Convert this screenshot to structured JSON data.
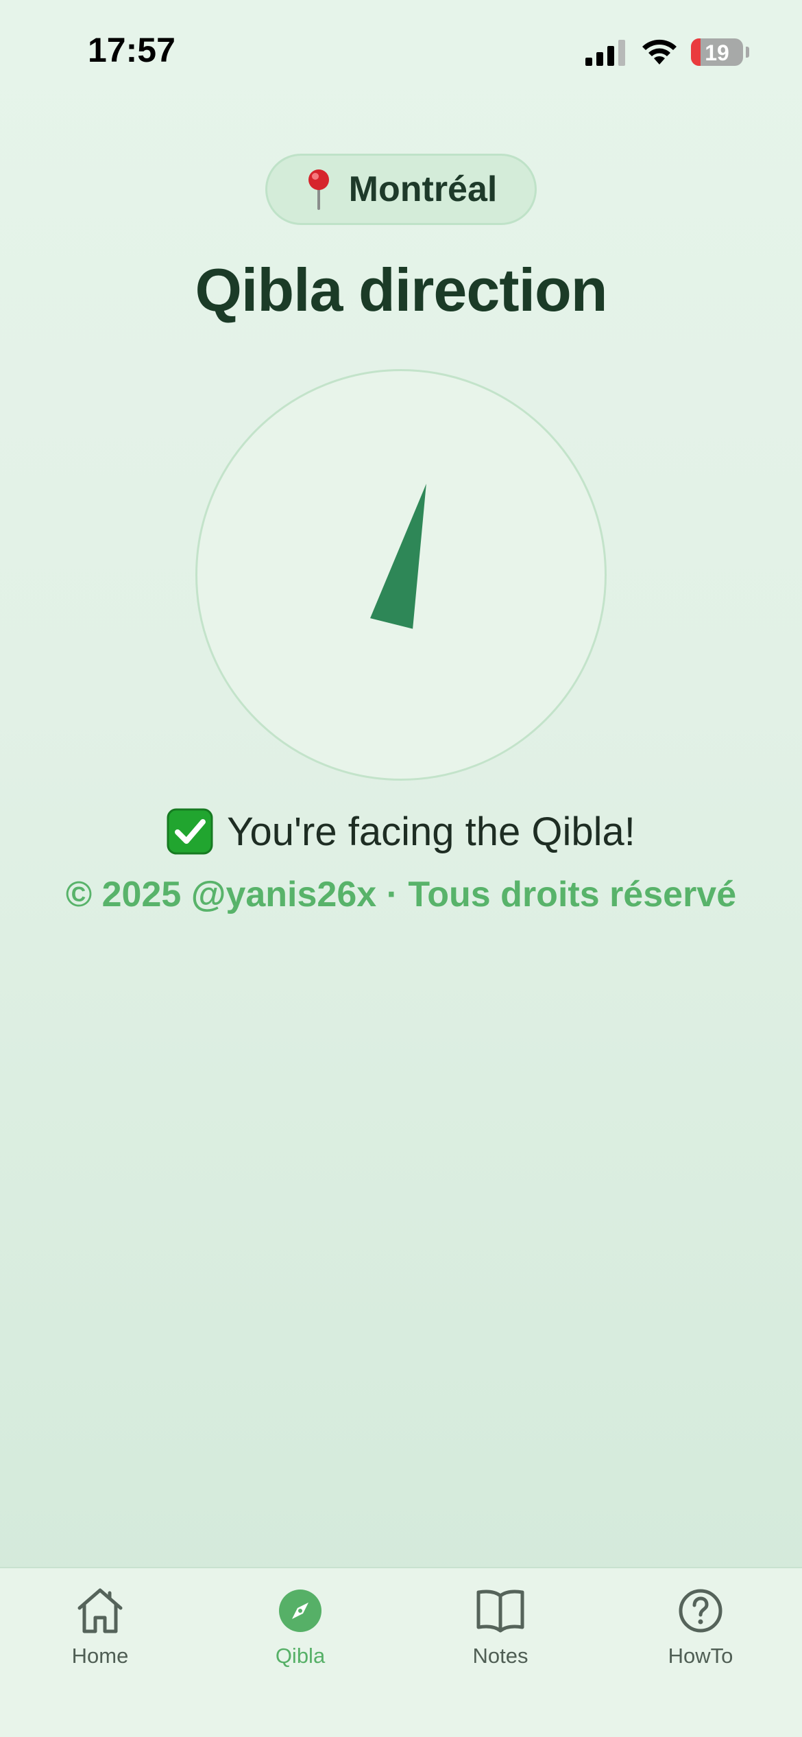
{
  "status_bar": {
    "time": "17:57",
    "battery_level": "19",
    "battery_fraction": 0.19,
    "battery_color": "#ea3b3e"
  },
  "location": {
    "icon": "pushpin-icon",
    "name": "Montréal"
  },
  "page": {
    "title": "Qibla direction"
  },
  "compass": {
    "needle_heading_degrees": 14,
    "needle_color": "#2e8757"
  },
  "status": {
    "icon": "check-mark-icon",
    "message": "You're facing the Qibla!"
  },
  "footer": {
    "copyright": "© 2025 @yanis26x · Tous droits réservé"
  },
  "tab_bar": {
    "active_color": "#56b067",
    "items": [
      {
        "label": "Home",
        "icon": "house-icon",
        "active": false
      },
      {
        "label": "Qibla",
        "icon": "compass-icon",
        "active": true
      },
      {
        "label": "Notes",
        "icon": "book-icon",
        "active": false
      },
      {
        "label": "HowTo",
        "icon": "question-icon",
        "active": false
      }
    ]
  }
}
